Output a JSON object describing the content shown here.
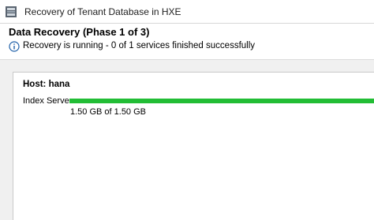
{
  "window": {
    "title": "Recovery of Tenant Database in HXE",
    "icon": "database-window-icon"
  },
  "header": {
    "heading": "Data Recovery (Phase 1 of 3)",
    "status_icon": "info-icon",
    "status_text": "Recovery is running - 0 of 1 services finished successfully"
  },
  "host": {
    "label": "Host: hana",
    "services": [
      {
        "name": "Index Server",
        "progress_fraction": 1.0,
        "progress_text": "1.50 GB of 1.50 GB"
      }
    ]
  },
  "colors": {
    "progress_fill": "#22bd35",
    "content_background": "#f0f0f0"
  }
}
